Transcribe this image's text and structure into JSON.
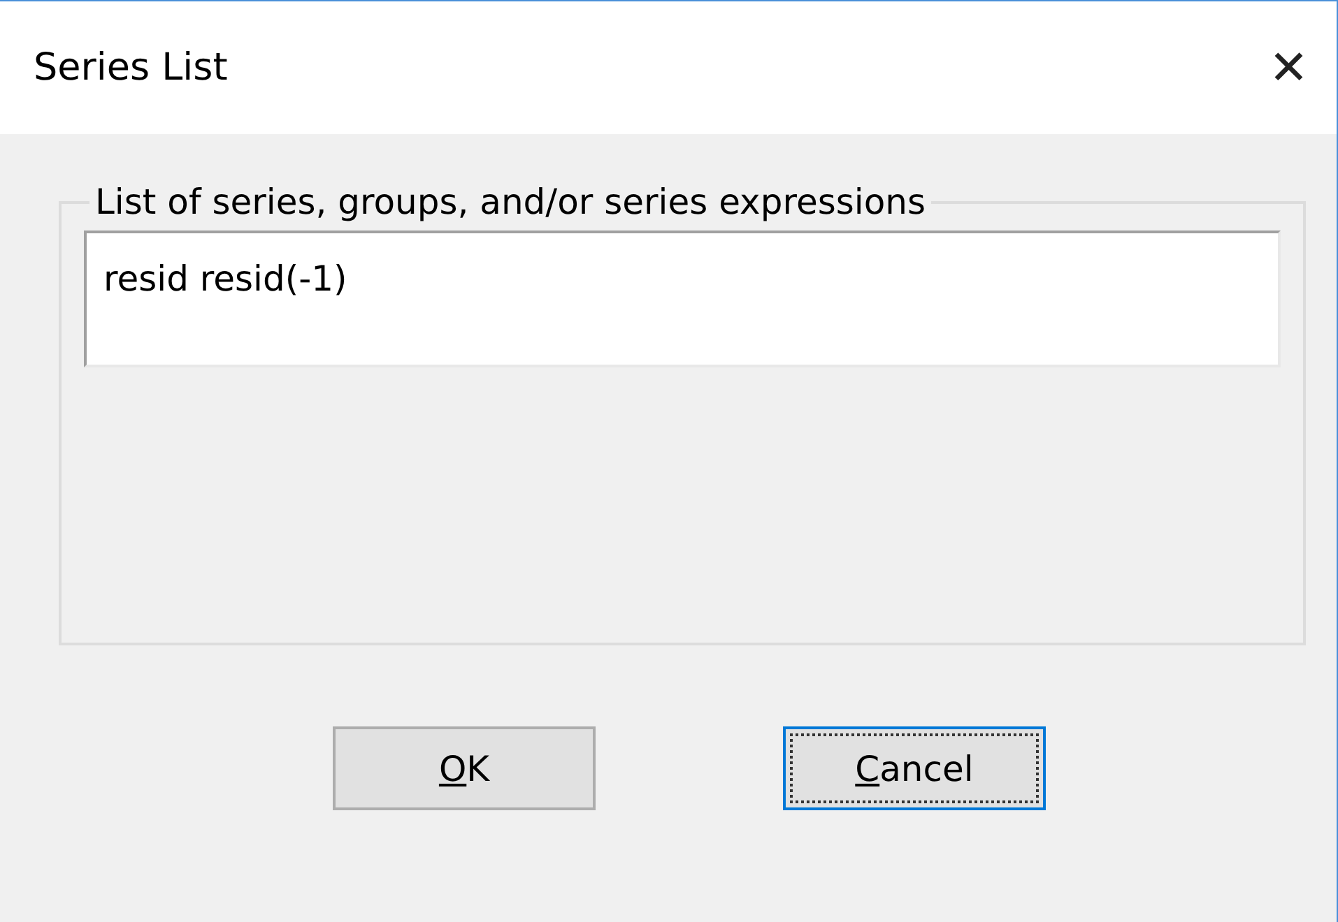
{
  "window": {
    "title": "Series List",
    "close": "✕"
  },
  "group": {
    "legend": "List of series, groups, and/or series expressions",
    "value": "resid resid(-1)"
  },
  "buttons": [
    {
      "access_key": "O",
      "rest": "K",
      "focused": false
    },
    {
      "access_key": "C",
      "rest": "ancel",
      "focused": true
    }
  ]
}
